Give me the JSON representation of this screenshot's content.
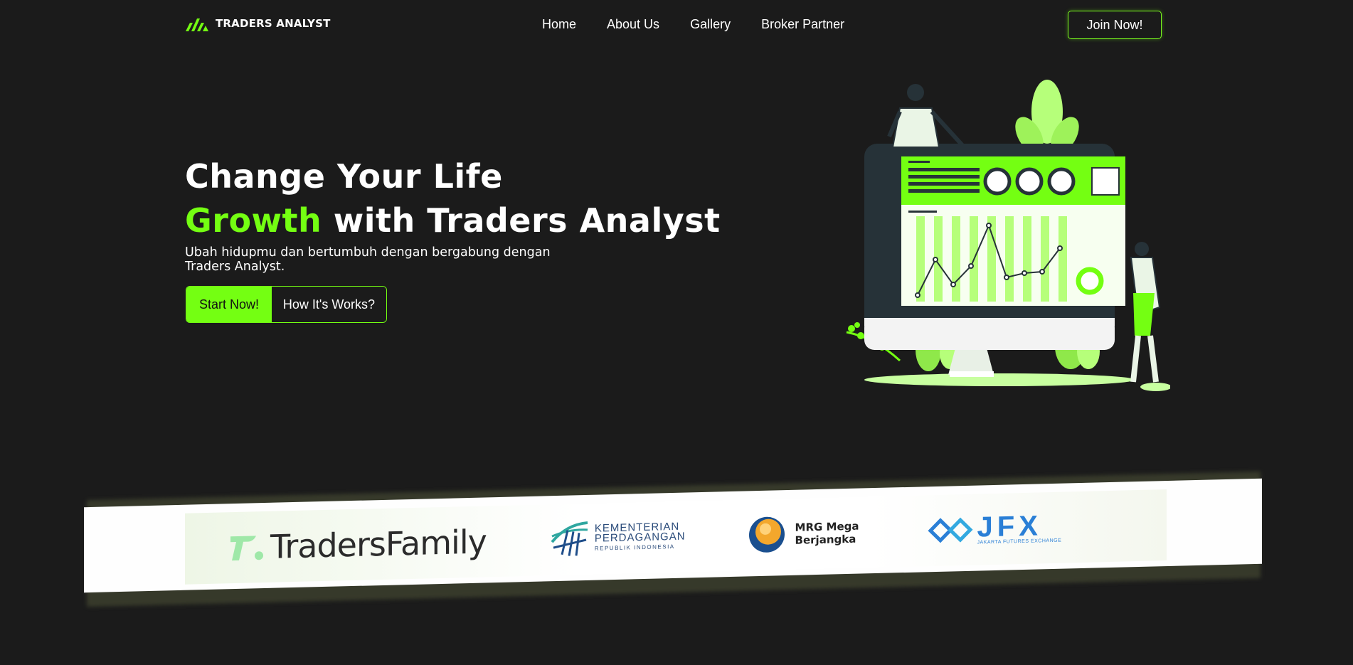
{
  "nav": {
    "brand": "TRADERS ANALYST",
    "items": [
      {
        "label": "Home"
      },
      {
        "label": "About Us"
      },
      {
        "label": "Gallery"
      },
      {
        "label": "Broker Partner"
      }
    ],
    "join_label": "Join Now!"
  },
  "hero": {
    "line1": "Change Your Life",
    "line2_highlight": "Growth",
    "line2_rest": " with Traders Analyst",
    "subtitle": "Ubah hidupmu dan bertumbuh dengan bergabung dengan Traders Analyst.",
    "start_label": "Start Now!",
    "how_label": "How It's Works?"
  },
  "partners": {
    "traders_family": "TradersFamily",
    "kemendag_line1": "KEMENTERIAN",
    "kemendag_line2": "PERDAGANGAN",
    "kemendag_line3": "REPUBLIK INDONESIA",
    "mrg_line1": "MRG Mega",
    "mrg_line2": "Berjangka",
    "jfx": "JFX",
    "jfx_sub": "JAKARTA FUTURES EXCHANGE"
  },
  "colors": {
    "accent": "#74ff12",
    "background": "#1b1b1b",
    "monitor_frame": "#263238"
  },
  "icons": [
    "brand-logo-icon",
    "dashboard-illustration",
    "traders-family-logo-icon",
    "kemendag-logo-icon",
    "mrg-logo-icon",
    "jfx-logo-icon"
  ]
}
